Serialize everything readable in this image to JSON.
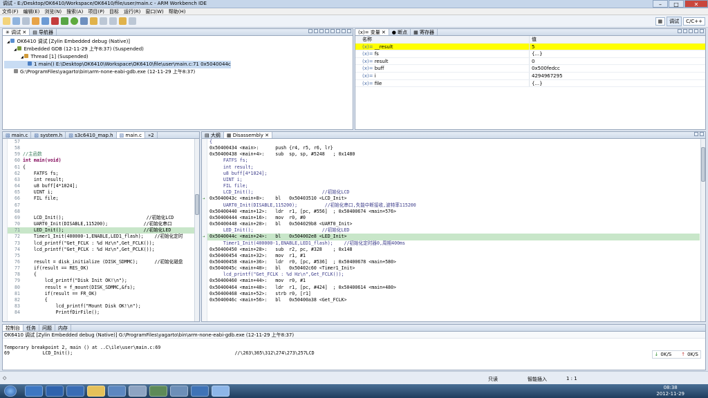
{
  "window": {
    "title": "调试 - E:/Desktop/OK6410/Workspace/OK6410/file/user/main.c - ARM Workbench IDE"
  },
  "menu": [
    "文件(F)",
    "编辑(E)",
    "浏览(N)",
    "搜索(A)",
    "项目(P)",
    "目标",
    "运行(R)",
    "窗口(W)",
    "帮助(H)"
  ],
  "perspectives": {
    "debug": "调试",
    "cpp": "C/C++"
  },
  "debug_view": {
    "tabs": [
      "调试",
      "导航器"
    ],
    "tree": [
      {
        "level": 0,
        "text": "OK6410 调试 [Zylin Embedded debug (Native)]",
        "icon": "launch-icon"
      },
      {
        "level": 1,
        "text": "Embedded GDB (12-11-29 上午8:37) (Suspended)",
        "icon": "gdb-icon"
      },
      {
        "level": 2,
        "text": "Thread [1] (Suspended)",
        "icon": "thread-icon"
      },
      {
        "level": 3,
        "text": "1 main() E:\\Desktop\\OK6410\\Workspace\\OK6410\\file\\user\\main.c:71 0x5040044c",
        "icon": "stack-frame-icon",
        "selected": true
      },
      {
        "level": 1,
        "text": "G:\\ProgramFiles\\yagarto\\bin\\arm-none-eabi-gdb.exe (12-11-29 上午8:37)",
        "icon": "process-icon"
      }
    ]
  },
  "variables_view": {
    "tabs": [
      "变量",
      "断点",
      "寄存器"
    ],
    "headers": [
      "名称",
      "值"
    ],
    "rows": [
      {
        "name": "__result",
        "value": "5",
        "highlight": true
      },
      {
        "name": "fs",
        "value": "{...}"
      },
      {
        "name": "result",
        "value": "0"
      },
      {
        "name": "buff",
        "value": "0x500fedcc"
      },
      {
        "name": "i",
        "value": "4294967295"
      },
      {
        "name": "file",
        "value": "{...}"
      }
    ]
  },
  "editor": {
    "tabs": [
      "main.c",
      "system.h",
      "s3c6410_map.h",
      "main.c",
      "»2"
    ],
    "lines": [
      {
        "n": "57",
        "t": ""
      },
      {
        "n": "58",
        "t": ""
      },
      {
        "n": "59",
        "t": "//主函数",
        "cls": "cm"
      },
      {
        "n": "60",
        "t": "int main(void)",
        "cls": "kw"
      },
      {
        "n": "61",
        "t": "{"
      },
      {
        "n": "62",
        "t": "    FATFS fs;"
      },
      {
        "n": "63",
        "t": "    int result;"
      },
      {
        "n": "64",
        "t": "    u8 buff[4*1024];"
      },
      {
        "n": "65",
        "t": "    UINT i;"
      },
      {
        "n": "66",
        "t": "    FIL file;"
      },
      {
        "n": "67",
        "t": ""
      },
      {
        "n": "68",
        "t": ""
      },
      {
        "n": "69",
        "t": "    LCD_Init();                              //初始化LCD"
      },
      {
        "n": "70",
        "t": "    UART0_Init(DISABLE,115200);             //初始化串口"
      },
      {
        "n": "71",
        "t": "    LED_Init();                             //初始化LED",
        "hl": "ln-hl"
      },
      {
        "n": "72",
        "t": "    Timer1_Init(400000-1,ENABLE,LED1_flash);    //初始化定时"
      },
      {
        "n": "73",
        "t": "    lcd_printf(\"Get_FCLK : %d Hz\\n\",Get_FCLK());"
      },
      {
        "n": "74",
        "t": "    lcd_printf(\"Get_PCLK : %d Hz\\n\",Get_PCLK());"
      },
      {
        "n": "75",
        "t": ""
      },
      {
        "n": "76",
        "t": "    result = disk_initialize (DISK_SDMMC);      //初始化磁盘"
      },
      {
        "n": "77",
        "t": "    if(result == RES_OK)"
      },
      {
        "n": "78",
        "t": "    {"
      },
      {
        "n": "79",
        "t": "        lcd_printf(\"Disk Init OK!\\n\");"
      },
      {
        "n": "80",
        "t": "        result = f_mount(DISK_SDMMC,&fs);"
      },
      {
        "n": "81",
        "t": "        if(result == FR_OK)"
      },
      {
        "n": "82",
        "t": "        {"
      },
      {
        "n": "83",
        "t": "            lcd_printf(\"Mount Disk OK!\\n\");"
      },
      {
        "n": "84",
        "t": "            PrintfDirFile();"
      }
    ]
  },
  "disassembly": {
    "tabs": [
      "大纲",
      "Disassembly"
    ],
    "lines": [
      {
        "t": "{"
      },
      {
        "t": "0x50400434 <main>:      push {r4, r5, r6, lr}"
      },
      {
        "t": "0x50400438 <main+4>:    sub  sp, sp, #5248   ; 0x1480"
      },
      {
        "t": "     FATFS fs;"
      },
      {
        "t": "     int result;"
      },
      {
        "t": "     u8 buff[4*1024];"
      },
      {
        "t": "     UINT i;"
      },
      {
        "t": "     FIL file;"
      },
      {
        "t": ""
      },
      {
        "t": ""
      },
      {
        "t": "     LCD_Init();                         //初始化LCD"
      },
      {
        "t": "0x5040043c <main+8>:    bl   0x50403510 <LCD_Init>",
        "marker": true
      },
      {
        "t": "     UART0_Init(DISABLE,115200);          //初始化串口,失能中断接收,波特率115200"
      },
      {
        "t": "0x50400440 <main+12>:   ldr  r1, [pc, #556]  ; 0x50400674 <main+576>"
      },
      {
        "t": "0x50400444 <main+16>:   mov  r0, #0"
      },
      {
        "t": "0x50400448 <main+20>:   bl   0x504029b8 <UART0_Init>"
      },
      {
        "t": "     LED_Init();                         //初始化LED"
      },
      {
        "t": "0x5040044c <main+24>:   bl   0x504002e8 <LED_Init>",
        "hl": "ln-hl",
        "marker": true
      },
      {
        "t": "     Timer1_Init(400000-1,ENABLE,LED1_flash);    //初始化定时器0,周期400ms"
      },
      {
        "t": "0x50400450 <main+28>:   sub  r2, pc, #328    ; 0x148"
      },
      {
        "t": "0x50400454 <main+32>:   mov  r1, #1"
      },
      {
        "t": "0x50400458 <main+36>:   ldr  r0, [pc, #536]  ; 0x50400678 <main+580>"
      },
      {
        "t": "0x5040045c <main+40>:   bl   0x50402c60 <Timer1_Init>"
      },
      {
        "t": "     lcd_printf(\"Get_FCLK : %d Hz\\n\",Get_FCLK());"
      },
      {
        "t": "0x50400460 <main+44>:   mov  r0, #1"
      },
      {
        "t": "0x50400464 <main+48>:   ldr  r1, [pc, #424]  ; 0x50400614 <main+480>"
      },
      {
        "t": "0x50400468 <main+52>:   strb r0, [r1]"
      },
      {
        "t": "0x5040046c <main+56>:   bl   0x50400a38 <Get_FCLK>"
      }
    ]
  },
  "console": {
    "tabs": [
      "控制台",
      "任务",
      "问题",
      "内存"
    ],
    "header": "OK6410 调试 [Zylin Embedded debug (Native)] G:\\ProgramFiles\\yagarto\\bin\\arm-none-eabi-gdb.exe (12-11-29 上午8:37)",
    "lines": [
      "",
      "Temporary breakpoint 2, main () at ..C\\ile\\user\\main.c:69",
      "69            LCD_Init();                                                           //\\263\\365\\312\\274\\273\\257LCD"
    ],
    "speed": [
      "0K/S",
      "0K/S"
    ]
  },
  "status": {
    "mode": "只读",
    "insert": "智能插入",
    "pos": "1 : 1"
  },
  "clock": {
    "time": "08:38",
    "date": "2012-11-29"
  }
}
